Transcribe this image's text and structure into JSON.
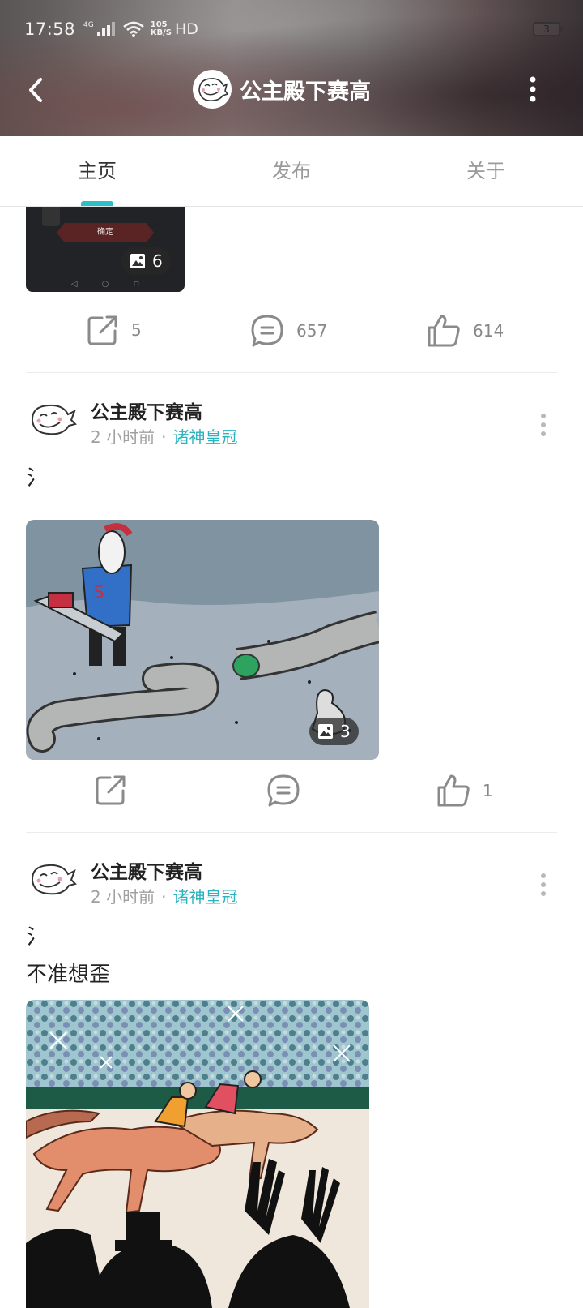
{
  "status_bar": {
    "time": "17:58",
    "network": "4G",
    "speed_value": "105",
    "speed_unit": "KB/S",
    "hd": "HD",
    "battery": "3"
  },
  "header": {
    "title": "公主殿下赛高",
    "avatar_icon": "troll-face-avatar"
  },
  "tabs": [
    {
      "label": "主页",
      "active": true
    },
    {
      "label": "发布",
      "active": false
    },
    {
      "label": "关于",
      "active": false
    }
  ],
  "previous_post": {
    "thumb_button_text": "确定",
    "image_count": "6",
    "share_count": "5",
    "comment_count": "657",
    "like_count": "614"
  },
  "posts": [
    {
      "author": "公主殿下赛高",
      "time": "2 小时前",
      "separator": "·",
      "game": "诸神皇冠",
      "text_lines": [
        "氵"
      ],
      "image_desc": "cartoon-hero-and-sliced-worm",
      "image_count": "3",
      "share_count": "",
      "comment_count": "",
      "like_count": "1"
    },
    {
      "author": "公主殿下赛高",
      "time": "2 小时前",
      "separator": "·",
      "game": "诸神皇冠",
      "text_lines": [
        "氵",
        "不准想歪"
      ],
      "image_desc": "horse-race-crowd-drawing"
    }
  ],
  "colors": {
    "accent": "#2bbfc7",
    "game_link": "#2bb3c0",
    "muted": "#9a9a9a"
  }
}
